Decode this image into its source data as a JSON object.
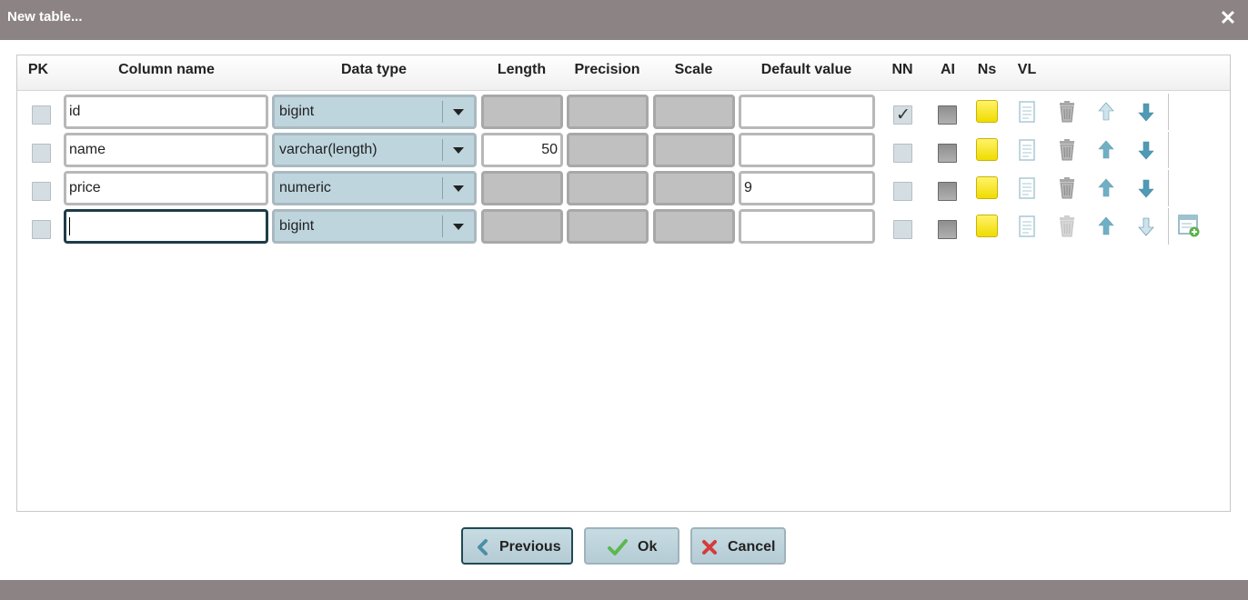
{
  "window": {
    "title": "New table...",
    "close_icon": "close-icon"
  },
  "columns_header": [
    "PK",
    "Column name",
    "Data type",
    "Length",
    "Precision",
    "Scale",
    "Default value",
    "NN",
    "AI",
    "Ns",
    "VL"
  ],
  "rows": [
    {
      "pk": false,
      "name": "id",
      "type": "bigint",
      "length": "",
      "length_enabled": false,
      "default": "",
      "nn": true,
      "ai": false,
      "last": false
    },
    {
      "pk": false,
      "name": "name",
      "type": "varchar(length)",
      "length": "50",
      "length_enabled": true,
      "default": "",
      "nn": false,
      "ai": false,
      "last": false
    },
    {
      "pk": false,
      "name": "price",
      "type": "numeric",
      "length": "",
      "length_enabled": false,
      "default": "9",
      "nn": false,
      "ai": false,
      "last": false
    },
    {
      "pk": false,
      "name": "",
      "type": "bigint",
      "length": "",
      "length_enabled": false,
      "default": "",
      "nn": false,
      "ai": false,
      "last": true
    }
  ],
  "buttons": {
    "previous": "Previous",
    "ok": "Ok",
    "cancel": "Cancel"
  },
  "colors": {
    "titlebar": "#8c8484",
    "select_bg": "#bed5de",
    "focus_border": "#1e3c46",
    "note": "#fff36b"
  }
}
